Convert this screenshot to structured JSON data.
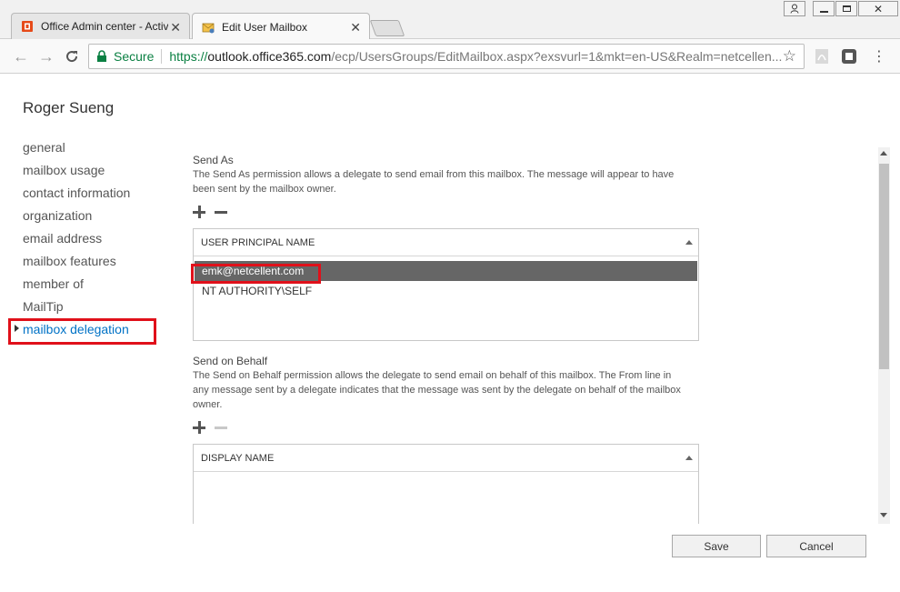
{
  "browser": {
    "tabs": [
      {
        "label": "Office Admin center - Active",
        "active": false
      },
      {
        "label": "Edit User Mailbox",
        "active": true
      }
    ],
    "address": {
      "secure_label": "Secure",
      "protocol": "https://",
      "host": "outlook.office365.com",
      "path": "/ecp/UsersGroups/EditMailbox.aspx?exsvurl=1&mkt=en-US&Realm=netcellen..."
    }
  },
  "page": {
    "title": "Roger Sueng",
    "nav": [
      {
        "label": "general"
      },
      {
        "label": "mailbox usage"
      },
      {
        "label": "contact information"
      },
      {
        "label": "organization"
      },
      {
        "label": "email address"
      },
      {
        "label": "mailbox features"
      },
      {
        "label": "member of"
      },
      {
        "label": "MailTip"
      },
      {
        "label": "mailbox delegation",
        "active": true
      }
    ],
    "send_as": {
      "title": "Send As",
      "description": "The Send As permission allows a delegate to send email from this mailbox. The message will appear to have been sent by the mailbox owner.",
      "column": "USER PRINCIPAL NAME",
      "rows": [
        {
          "value": "emk@netcellent.com",
          "selected": true
        },
        {
          "value": "NT AUTHORITY\\SELF",
          "selected": false
        }
      ]
    },
    "send_on_behalf": {
      "title": "Send on Behalf",
      "description": "The Send on Behalf permission allows the delegate to send email on behalf of this mailbox. The From line in any message sent by a delegate indicates that the message was sent by the delegate on behalf of the mailbox owner.",
      "column": "DISPLAY NAME",
      "rows": []
    },
    "buttons": {
      "save": "Save",
      "cancel": "Cancel"
    }
  },
  "colors": {
    "accent": "#0072c6",
    "highlight": "#e0101a",
    "selected_row": "#666666",
    "secure": "#0b8043"
  },
  "icons": [
    "office-icon",
    "mailbox-icon",
    "back-icon",
    "forward-icon",
    "reload-icon",
    "lock-icon",
    "star-icon",
    "pdf-icon",
    "extension-icon",
    "menu-icon",
    "user-icon",
    "minimize-icon",
    "restore-icon",
    "close-icon",
    "plus-icon",
    "minus-icon"
  ]
}
